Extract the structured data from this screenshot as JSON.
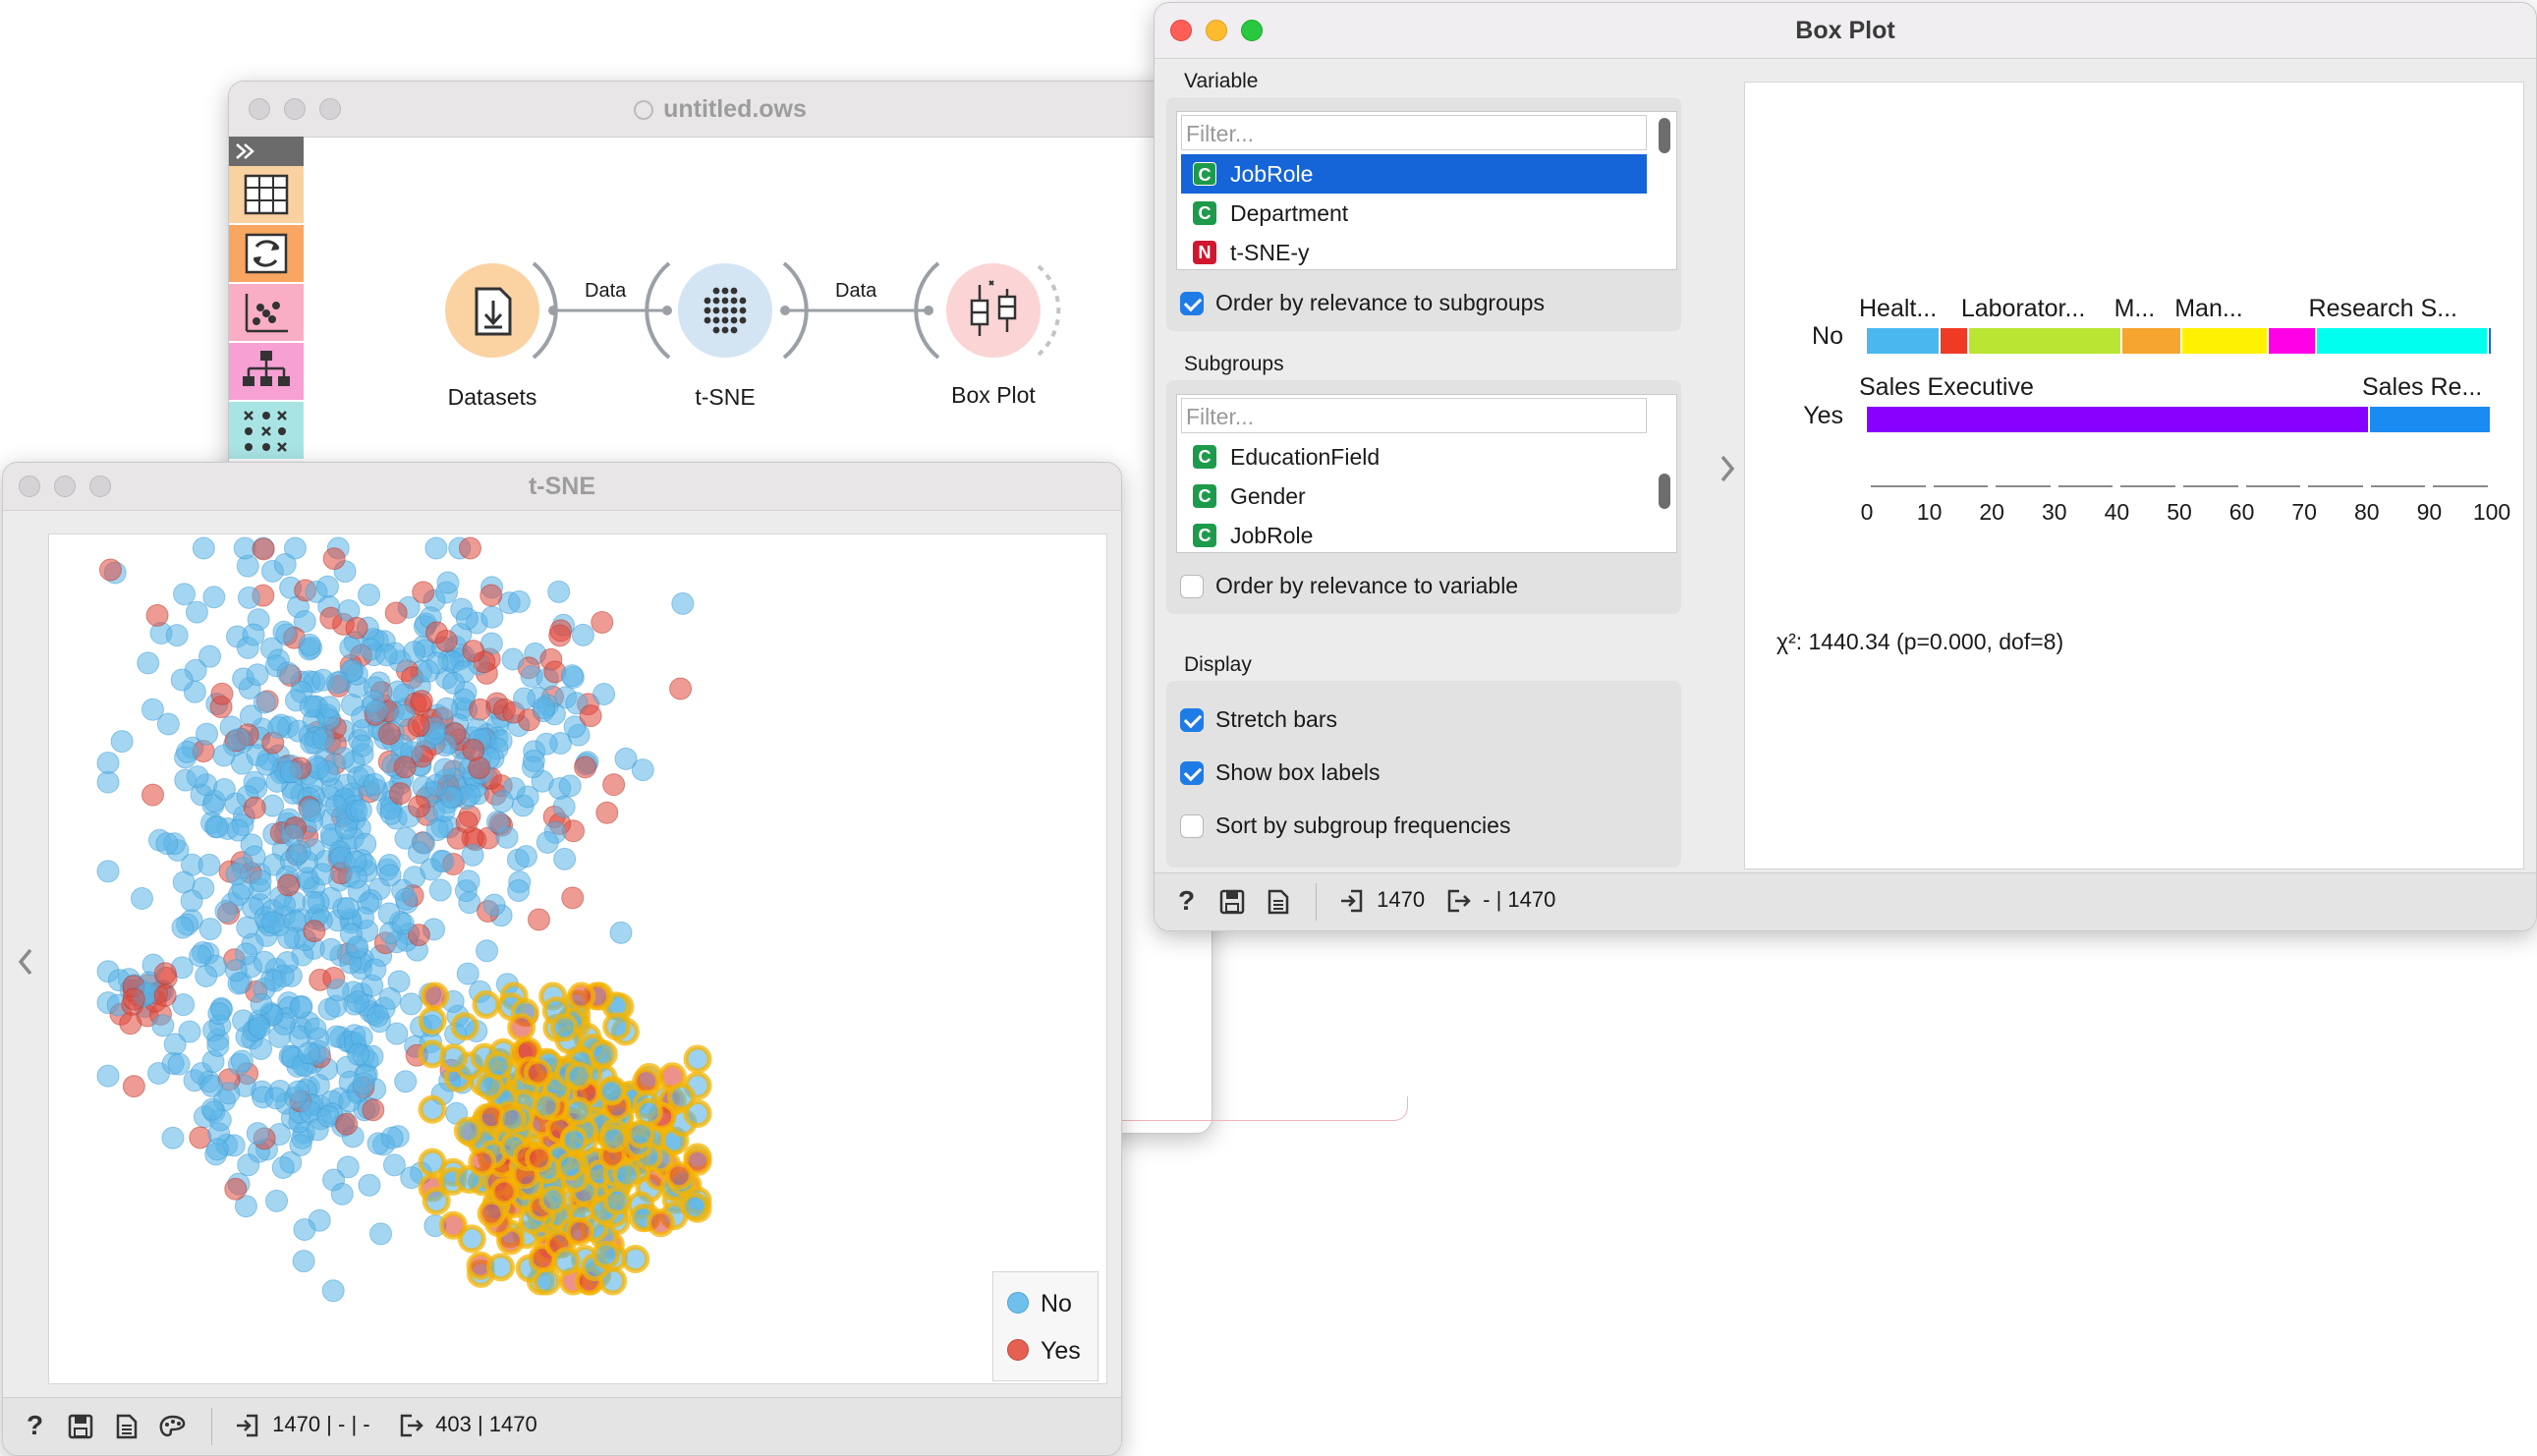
{
  "workflow": {
    "title": "untitled.ows",
    "nodes": [
      {
        "name": "Datasets",
        "icon": "file-import-icon",
        "color": "#fbd3a3"
      },
      {
        "name": "t-SNE",
        "icon": "dot-grid-icon",
        "color": "#d3e4f3"
      },
      {
        "name": "Box Plot",
        "icon": "boxplot-icon",
        "color": "#fbd5d6"
      }
    ],
    "links": [
      {
        "label": "Data"
      },
      {
        "label": "Data"
      }
    ],
    "toolbox": [
      "table-icon",
      "transform-icon",
      "scatter-icon",
      "hierarchy-icon",
      "matrix-icon"
    ]
  },
  "tsne": {
    "title": "t-SNE",
    "legend": [
      {
        "label": "No",
        "color": "#6fc0ec"
      },
      {
        "label": "Yes",
        "color": "#e66052"
      }
    ],
    "status": {
      "input": "1470 | - | -",
      "output": "403 | 1470"
    },
    "colors": {
      "no": "#5ab4e8",
      "yes": "#e0493c",
      "highlight": "#f6b400"
    }
  },
  "boxplot": {
    "title": "Box Plot",
    "variable": {
      "header": "Variable",
      "filter_placeholder": "Filter...",
      "items": [
        {
          "badge": "C",
          "label": "JobRole",
          "selected": true
        },
        {
          "badge": "C",
          "label": "Department",
          "selected": false
        },
        {
          "badge": "N",
          "label": "t-SNE-y",
          "selected": false
        }
      ],
      "order_label": "Order by relevance to subgroups",
      "order_checked": true
    },
    "subgroups": {
      "header": "Subgroups",
      "filter_placeholder": "Filter...",
      "items": [
        {
          "badge": "C",
          "label": "EducationField"
        },
        {
          "badge": "C",
          "label": "Gender"
        },
        {
          "badge": "C",
          "label": "JobRole"
        }
      ],
      "order_label": "Order by relevance to variable",
      "order_checked": false
    },
    "display": {
      "header": "Display",
      "options": [
        {
          "label": "Stretch bars",
          "checked": true
        },
        {
          "label": "Show box labels",
          "checked": true
        },
        {
          "label": "Sort by subgroup frequencies",
          "checked": false
        }
      ]
    },
    "chart_data": {
      "type": "bar",
      "orientation": "horizontal-stacked",
      "xlim": [
        0,
        100
      ],
      "ticks": [
        "0",
        "10",
        "20",
        "30",
        "40",
        "50",
        "60",
        "70",
        "80",
        "90",
        "100"
      ],
      "rows": [
        {
          "name": "No",
          "segments": [
            {
              "label": "Healt...",
              "value": 11.5,
              "color": "#4ab8ef"
            },
            {
              "label": "",
              "value": 4.5,
              "color": "#ef3b24"
            },
            {
              "label": "Laborator...",
              "value": 24,
              "color": "#b9e633"
            },
            {
              "label": "M...",
              "value": 9.5,
              "color": "#f6a52e"
            },
            {
              "label": "Man...",
              "value": 13.5,
              "color": "#fff200"
            },
            {
              "label": "",
              "value": 7.5,
              "color": "#ff00e6"
            },
            {
              "label": "Research S...",
              "value": 27,
              "color": "#00ffee"
            },
            {
              "label": "",
              "value": 0.5,
              "color": "#1a64f0"
            }
          ]
        },
        {
          "name": "Yes",
          "segments": [
            {
              "label": "Sales Executive",
              "value": 80.5,
              "color": "#8800ff"
            },
            {
              "label": "Sales Re...",
              "value": 19.5,
              "color": "#1a8bf0"
            }
          ]
        }
      ],
      "stat": "χ²: 1440.34 (p=0.000, dof=8)"
    },
    "status": {
      "input": "1470",
      "output": "- | 1470"
    }
  }
}
